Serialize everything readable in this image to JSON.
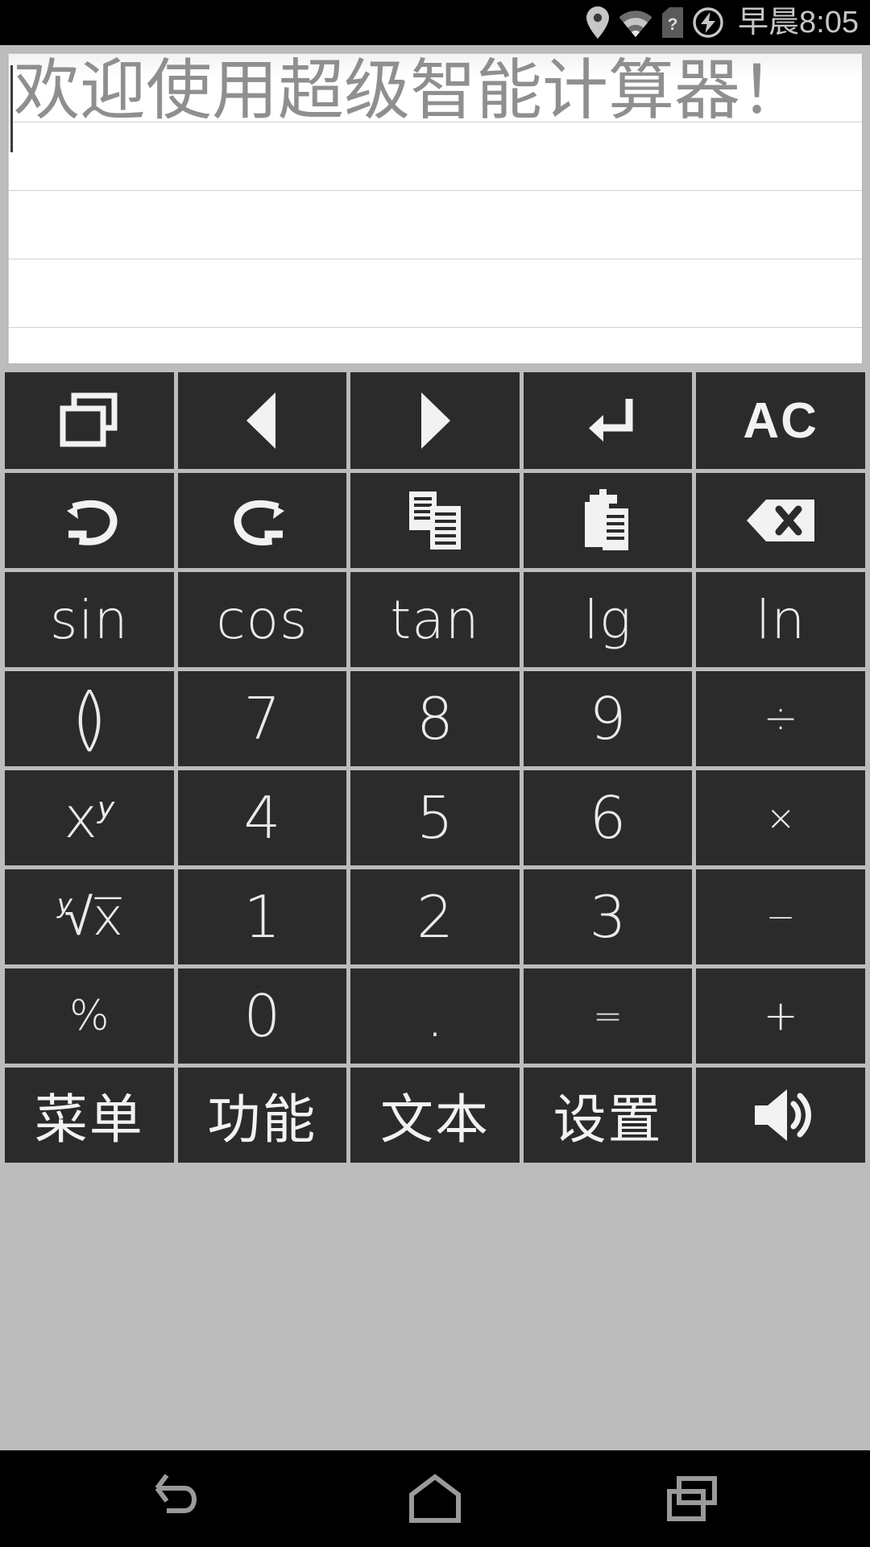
{
  "statusbar": {
    "time": "早晨8:05",
    "icons": [
      "location-pin-icon",
      "wifi-icon",
      "sim-card-question-icon",
      "battery-charging-icon"
    ]
  },
  "display": {
    "text": "欢迎使用超级智能计算器！",
    "line_count": 5,
    "text_color": "#8f8f8f",
    "background": "#ffffff",
    "caret_visible": true
  },
  "keypad": {
    "key_bg": "#2b2b2b",
    "key_fg": "#f2f2f2",
    "gap_color": "#bcbcbc",
    "rows": [
      [
        {
          "name": "multi-window-key",
          "label": "",
          "icon": "multi-window-icon"
        },
        {
          "name": "cursor-left-key",
          "label": "",
          "icon": "triangle-left-icon"
        },
        {
          "name": "cursor-right-key",
          "label": "",
          "icon": "triangle-right-icon"
        },
        {
          "name": "enter-key",
          "label": "",
          "icon": "enter-return-icon"
        },
        {
          "name": "all-clear-key",
          "label": "AC",
          "icon": ""
        }
      ],
      [
        {
          "name": "undo-key",
          "label": "",
          "icon": "undo-icon"
        },
        {
          "name": "redo-key",
          "label": "",
          "icon": "redo-icon"
        },
        {
          "name": "copy-key",
          "label": "",
          "icon": "copy-icon"
        },
        {
          "name": "paste-key",
          "label": "",
          "icon": "paste-icon"
        },
        {
          "name": "backspace-key",
          "label": "",
          "icon": "backspace-icon"
        }
      ],
      [
        {
          "name": "sin-key",
          "label": "sin",
          "icon": ""
        },
        {
          "name": "cos-key",
          "label": "cos",
          "icon": ""
        },
        {
          "name": "tan-key",
          "label": "tan",
          "icon": ""
        },
        {
          "name": "lg-key",
          "label": "lg",
          "icon": ""
        },
        {
          "name": "ln-key",
          "label": "ln",
          "icon": ""
        }
      ],
      [
        {
          "name": "parentheses-key",
          "label": "()",
          "icon": ""
        },
        {
          "name": "digit-7-key",
          "label": "7",
          "icon": ""
        },
        {
          "name": "digit-8-key",
          "label": "8",
          "icon": ""
        },
        {
          "name": "digit-9-key",
          "label": "9",
          "icon": ""
        },
        {
          "name": "divide-key",
          "label": "÷",
          "icon": ""
        }
      ],
      [
        {
          "name": "power-key",
          "label": "x^y",
          "icon": ""
        },
        {
          "name": "digit-4-key",
          "label": "4",
          "icon": ""
        },
        {
          "name": "digit-5-key",
          "label": "5",
          "icon": ""
        },
        {
          "name": "digit-6-key",
          "label": "6",
          "icon": ""
        },
        {
          "name": "multiply-key",
          "label": "×",
          "icon": ""
        }
      ],
      [
        {
          "name": "nth-root-key",
          "label": "y√x",
          "icon": ""
        },
        {
          "name": "digit-1-key",
          "label": "1",
          "icon": ""
        },
        {
          "name": "digit-2-key",
          "label": "2",
          "icon": ""
        },
        {
          "name": "digit-3-key",
          "label": "3",
          "icon": ""
        },
        {
          "name": "minus-key",
          "label": "−",
          "icon": ""
        }
      ],
      [
        {
          "name": "percent-key",
          "label": "%",
          "icon": ""
        },
        {
          "name": "digit-0-key",
          "label": "0",
          "icon": ""
        },
        {
          "name": "decimal-point-key",
          "label": ".",
          "icon": ""
        },
        {
          "name": "equals-key",
          "label": "=",
          "icon": ""
        },
        {
          "name": "plus-key",
          "label": "+",
          "icon": ""
        }
      ],
      [
        {
          "name": "menu-key",
          "label": "菜单",
          "icon": ""
        },
        {
          "name": "function-key",
          "label": "功能",
          "icon": ""
        },
        {
          "name": "text-key",
          "label": "文本",
          "icon": ""
        },
        {
          "name": "settings-key",
          "label": "设置",
          "icon": ""
        },
        {
          "name": "sound-key",
          "label": "",
          "icon": "speaker-volume-icon"
        }
      ]
    ]
  },
  "navbar": {
    "buttons": [
      {
        "name": "android-back-button",
        "icon": "back-arrow-icon"
      },
      {
        "name": "android-home-button",
        "icon": "home-icon"
      },
      {
        "name": "android-recents-button",
        "icon": "recents-icon"
      }
    ]
  }
}
